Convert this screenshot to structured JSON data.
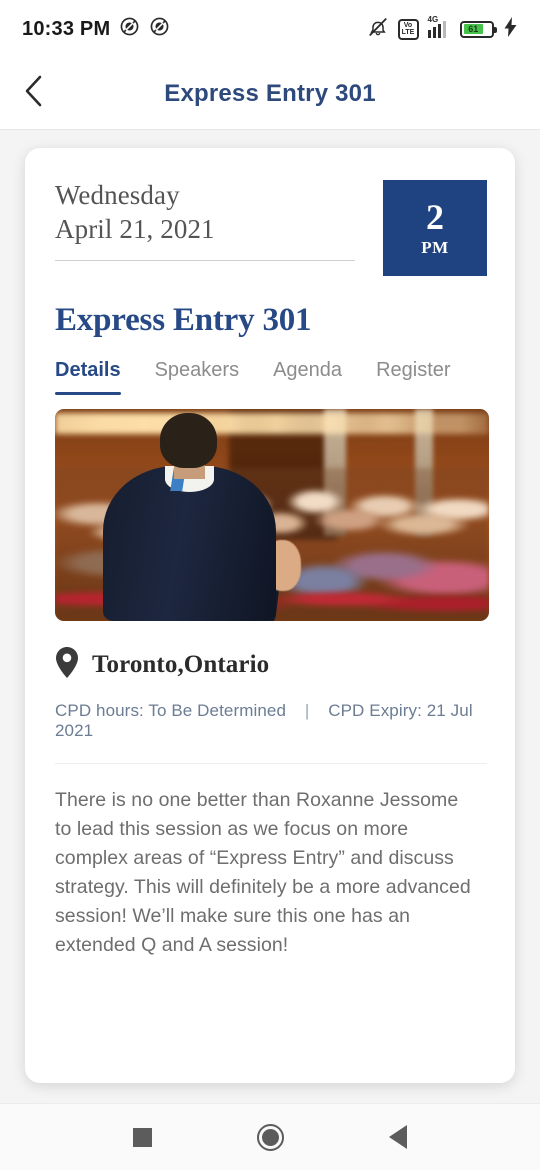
{
  "status_bar": {
    "time": "10:33 PM",
    "icons": [
      "dnd-icon",
      "dnd-secondary-icon",
      "mute-icon",
      "volte-icon",
      "signal-icon",
      "battery-icon"
    ],
    "network_type": "4G",
    "volte_top": "Vo",
    "volte_bottom": "LTE",
    "battery_percent": "61",
    "charging": true
  },
  "app_bar": {
    "back_label": "back-chevron",
    "title": "Express Entry 301"
  },
  "card": {
    "date": {
      "day_of_week": "Wednesday",
      "full_date": "April 21, 2021"
    },
    "time_badge": {
      "hour": "2",
      "meridiem": "PM"
    },
    "title": "Express Entry 301",
    "tabs": [
      {
        "label": "Details",
        "active": true
      },
      {
        "label": "Speakers",
        "active": false
      },
      {
        "label": "Agenda",
        "active": false
      },
      {
        "label": "Register",
        "active": false
      }
    ],
    "hero_image_alt": "speaker-addressing-conference-audience",
    "location": "Toronto,Ontario",
    "cpd_hours": "CPD hours: To Be Determined",
    "cpd_separator": "|",
    "cpd_expiry": "CPD Expiry: 21 Jul 2021",
    "description": "There is no one better than Roxanne Jessome to lead this session as we focus on more complex areas of “Express Entry” and discuss strategy. This will definitely be a more advanced session! We’ll make sure this one has an extended Q and A session!"
  },
  "nav_bar": {
    "recents": "recents-button",
    "home": "home-button",
    "back": "back-button"
  },
  "colors": {
    "navy": "#1e4380",
    "title_navy": "#274a86",
    "tab_inactive": "#8c8c8c",
    "cpd_text": "#6b7c93",
    "body_text": "#6e6e6e",
    "battery_green": "#46c14a"
  }
}
